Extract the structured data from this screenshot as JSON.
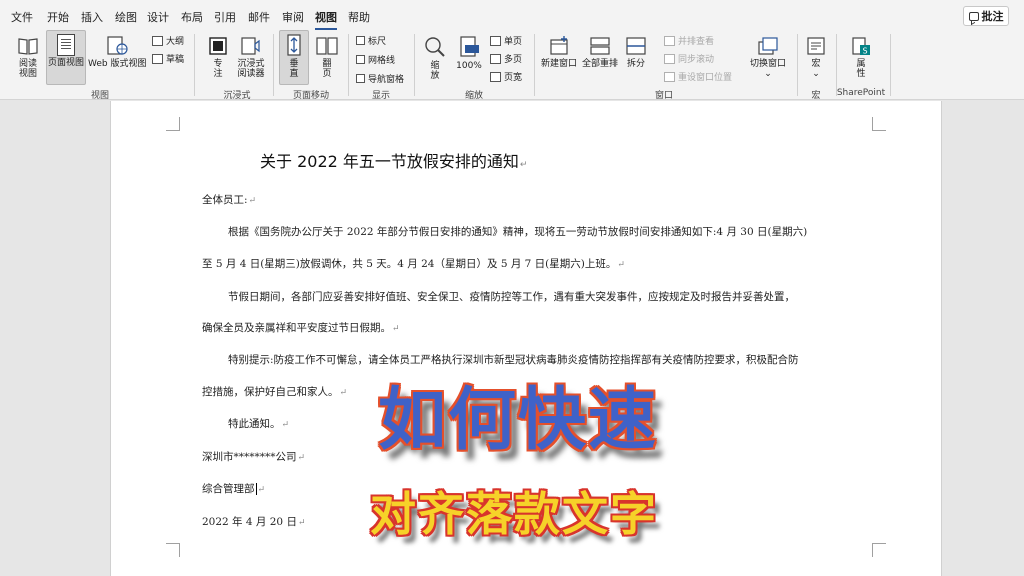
{
  "menu": {
    "tabs": [
      "文件",
      "开始",
      "插入",
      "绘图",
      "设计",
      "布局",
      "引用",
      "邮件",
      "审阅",
      "视图",
      "帮助"
    ],
    "active_tab": "视图",
    "comment_label": "批注"
  },
  "ribbon": {
    "views": {
      "read_mode": "阅读\n视图",
      "print_layout": "页面视图",
      "web_layout": "Web 版式视图",
      "outline": "大纲",
      "draft": "草稿",
      "group_label": "视图"
    },
    "immersive": {
      "focus": "专\n注",
      "immersive_reader": "沉浸式\n阅读器",
      "group_label": "沉浸式"
    },
    "page_movement": {
      "vertical": "垂\n直",
      "side_to_side": "翻\n页",
      "group_label": "页面移动"
    },
    "show": {
      "ruler": "标尺",
      "gridlines": "网格线",
      "navigation_pane": "导航窗格",
      "group_label": "显示"
    },
    "zoom": {
      "zoom": "缩\n放",
      "hundred": "100%",
      "one_page": "单页",
      "multiple_pages": "多页",
      "page_width": "页宽",
      "group_label": "缩放"
    },
    "window": {
      "new_window": "新建窗口",
      "arrange_all": "全部重排",
      "split": "拆分",
      "side_by_side": "并排查看",
      "sync_scroll": "同步滚动",
      "reset_position": "重设窗口位置",
      "switch_windows": "切换窗口",
      "group_label": "窗口"
    },
    "macros": {
      "macros": "宏",
      "group_label": "宏"
    },
    "sharepoint": {
      "properties": "属\n性",
      "group_label": "SharePoint"
    }
  },
  "document": {
    "title": "关于 2022 年五一节放假安排的通知",
    "salutation": "全体员工:",
    "p1_line1": "根据《国务院办公厅关于 2022 年部分节假日安排的通知》精神，现将五一劳动节放假时间安排通知如下:4 月 30 日(星期六)",
    "p1_line2": "至 5 月 4 日(星期三)放假调休，共 5 天。4 月 24（星期日）及 5 月 7 日(星期六)上班。",
    "p2_line1": "节假日期间，各部门应妥善安排好值班、安全保卫、疫情防控等工作，遇有重大突发事件，应按规定及时报告并妥善处置，",
    "p2_line2": "确保全员及亲属祥和平安度过节日假期。",
    "p3_line1": "特别提示:防疫工作不可懈怠，请全体员工严格执行深圳市新型冠状病毒肺炎疫情防控指挥部有关疫情防控要求，积极配合防",
    "p3_line2": "控措施，保护好自己和家人。",
    "closing": "特此通知。",
    "company": "深圳市********公司",
    "department": "综合管理部",
    "date": "2022 年 4 月 20 日",
    "para_mark": "↵"
  },
  "overlay": {
    "line1": "如何快速",
    "line2": "对齐落款文字"
  }
}
